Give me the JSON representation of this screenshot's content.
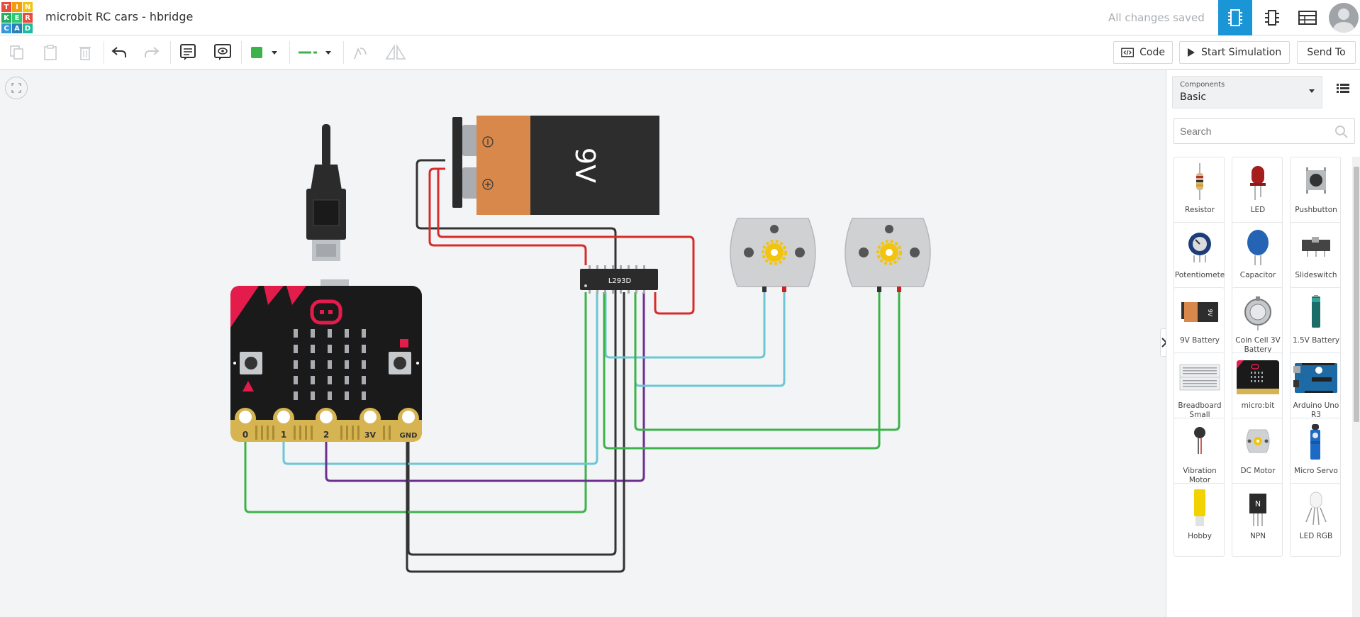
{
  "app": {
    "logo_letters": [
      "T",
      "I",
      "N",
      "K",
      "E",
      "R",
      "C",
      "A",
      "D"
    ],
    "title": "microbit RC cars - hbridge",
    "save_status": "All changes saved"
  },
  "toolbar": {
    "code_label": "Code",
    "simulate_label": "Start Simulation",
    "send_label": "Send To",
    "wire_color": "#3cb34a"
  },
  "canvas": {
    "battery_label": "9V",
    "chip_label": "L293D",
    "pins": [
      "0",
      "1",
      "2",
      "3V",
      "GND"
    ]
  },
  "panel": {
    "components_label": "Components",
    "components_value": "Basic",
    "search_placeholder": "Search",
    "items": [
      {
        "label": "Resistor",
        "icon": "resistor-icon"
      },
      {
        "label": "LED",
        "icon": "led-icon"
      },
      {
        "label": "Pushbutton",
        "icon": "pushbutton-icon"
      },
      {
        "label": "Potentiomete",
        "icon": "potentiometer-icon"
      },
      {
        "label": "Capacitor",
        "icon": "capacitor-icon"
      },
      {
        "label": "Slideswitch",
        "icon": "slideswitch-icon"
      },
      {
        "label": "9V Battery",
        "icon": "battery-9v-icon"
      },
      {
        "label": "Coin Cell 3V Battery",
        "icon": "coin-cell-icon"
      },
      {
        "label": "1.5V Battery",
        "icon": "battery-aa-icon"
      },
      {
        "label": "Breadboard Small",
        "icon": "breadboard-icon"
      },
      {
        "label": "micro:bit",
        "icon": "microbit-icon"
      },
      {
        "label": "Arduino Uno R3",
        "icon": "arduino-icon"
      },
      {
        "label": "Vibration Motor",
        "icon": "vibration-motor-icon"
      },
      {
        "label": "DC Motor",
        "icon": "dc-motor-icon"
      },
      {
        "label": "Micro Servo",
        "icon": "micro-servo-icon"
      },
      {
        "label": "Hobby",
        "icon": "hobby-gearmotor-icon"
      },
      {
        "label": "NPN",
        "icon": "npn-transistor-icon"
      },
      {
        "label": "LED RGB",
        "icon": "led-rgb-icon"
      }
    ]
  }
}
